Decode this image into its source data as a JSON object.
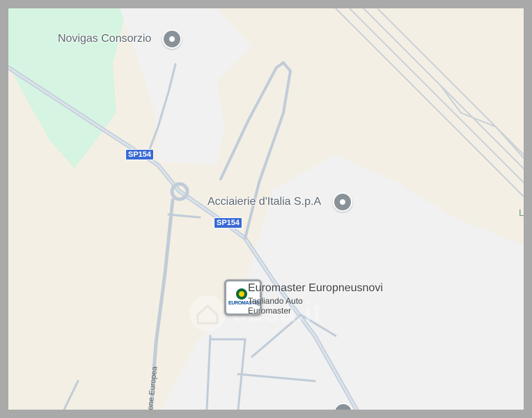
{
  "map": {
    "background_color": "#f4efe4",
    "park_color": "#d6f5e2",
    "industrial_color": "#f1f1f1",
    "road_color": "#b9c7d6",
    "pois": [
      {
        "name": "Novigas Consorzio",
        "icon": "location-pin-icon"
      },
      {
        "name": "Acciaierie d'Italia S.p.A",
        "icon": "location-pin-icon"
      }
    ],
    "road_shields": [
      "SP154",
      "SP154"
    ],
    "business": {
      "name": "Euromaster Europneusnovi",
      "subtitle_line1": "Tagliando Auto",
      "subtitle_line2": "Euromaster",
      "logo_text": "EUROMASTER"
    },
    "street_label": "one Europea",
    "edge_label": "L",
    "watermark": {
      "text": "casa.it",
      "icon": "house-icon"
    }
  }
}
